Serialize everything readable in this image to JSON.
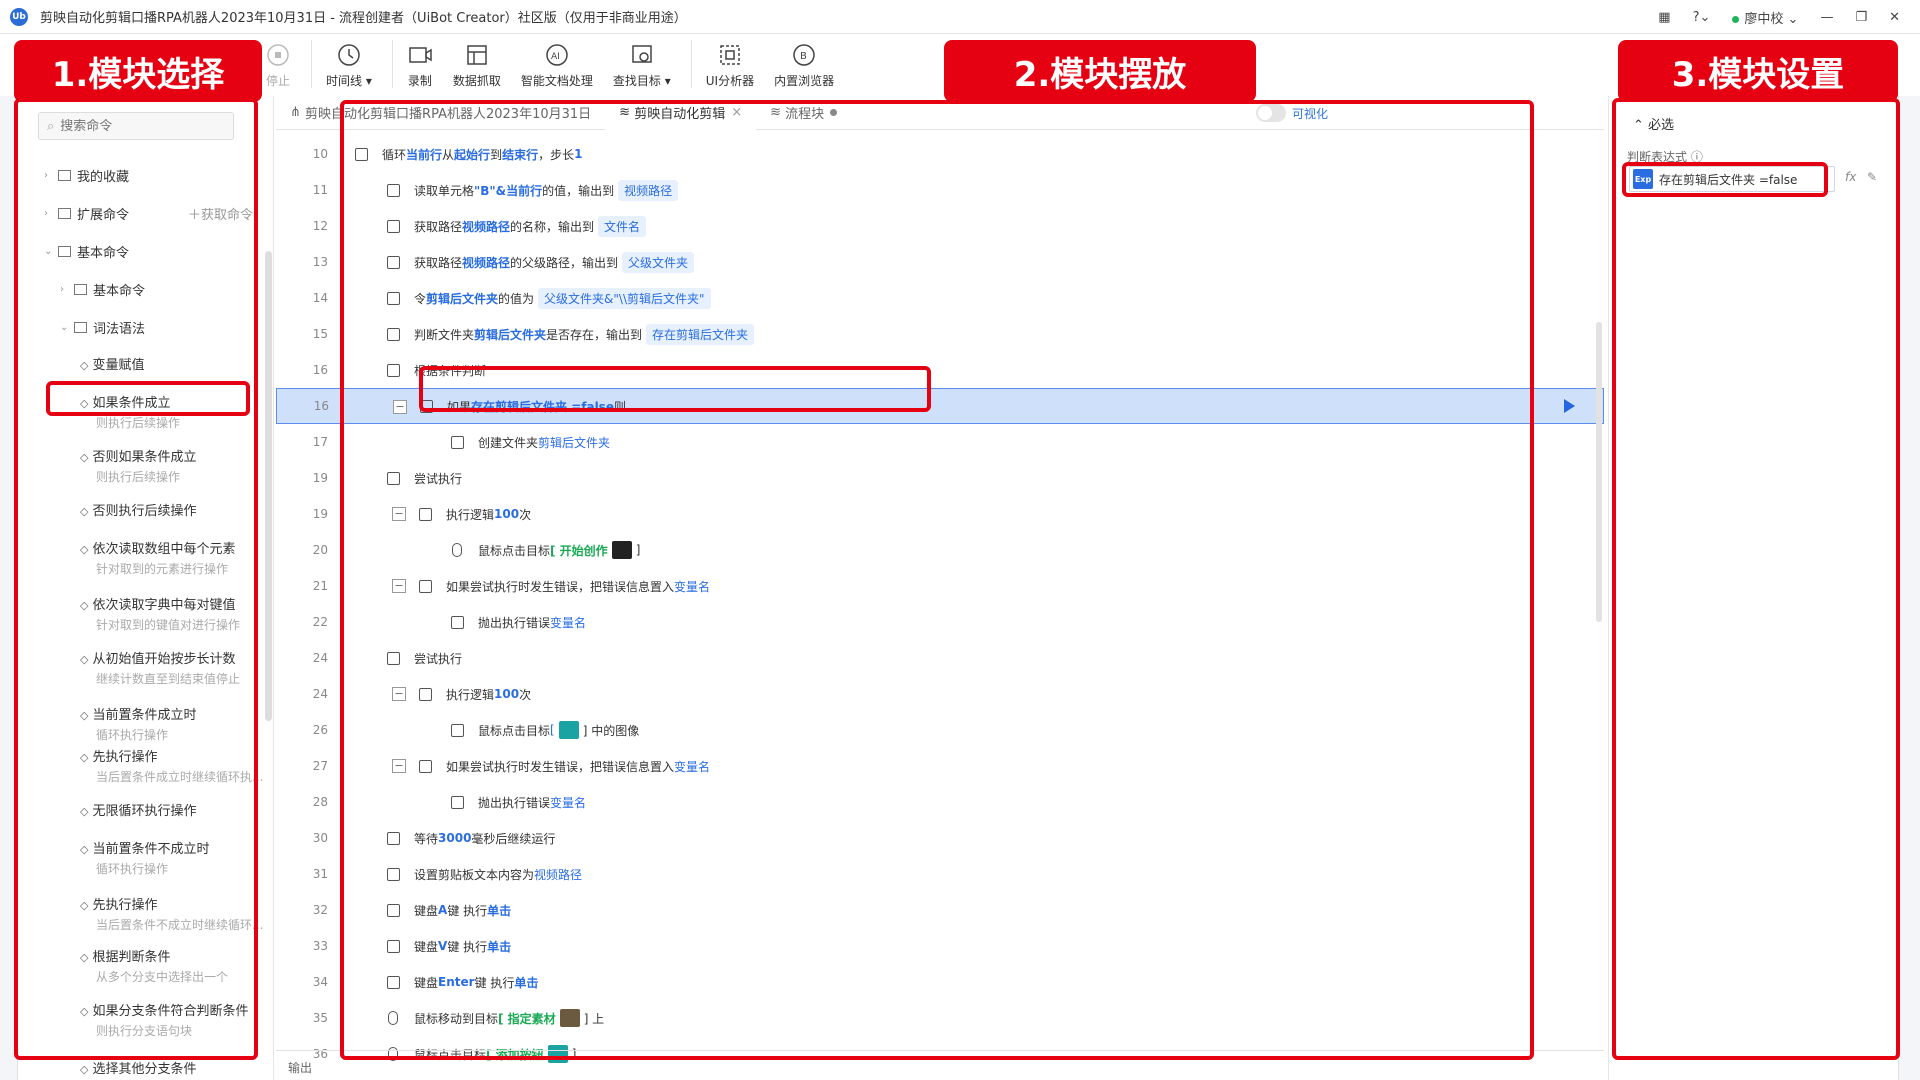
{
  "window": {
    "title": "剪映自动化剪辑口播RPA机器人2023年10月31日 - 流程创建者（UiBot Creator）社区版（仅用于非商业用途）",
    "logo": "Ub",
    "user": "廖中校"
  },
  "toolbar": {
    "stop": "停止",
    "timeline": "时间线",
    "record": "录制",
    "datagrab": "数据抓取",
    "smartdoc": "智能文档处理",
    "findtarget": "查找目标",
    "uianalyzer": "UI分析器",
    "browser": "内置浏览器"
  },
  "labels": {
    "l1": "1.模块选择",
    "l2": "2.模块摆放",
    "l3": "3.模块设置"
  },
  "left": {
    "search_placeholder": "搜索命令",
    "favorites": "我的收藏",
    "extension": "扩展命令",
    "get_cmd": "获取命令",
    "basic": "基本命令",
    "basic_sub": "基本命令",
    "syntax": "词法语法",
    "commands": [
      {
        "label": "变量赋值",
        "desc": ""
      },
      {
        "label": "如果条件成立",
        "desc": "则执行后续操作"
      },
      {
        "label": "否则如果条件成立",
        "desc": "则执行后续操作"
      },
      {
        "label": "否则执行后续操作",
        "desc": ""
      },
      {
        "label": "依次读取数组中每个元素",
        "desc": "针对取到的元素进行操作"
      },
      {
        "label": "依次读取字典中每对键值",
        "desc": "针对取到的键值对进行操作"
      },
      {
        "label": "从初始值开始按步长计数",
        "desc": "继续计数直至到结束值停止"
      },
      {
        "label": "当前置条件成立时",
        "desc": "循环执行操作"
      },
      {
        "label": "先执行操作",
        "desc": "当后置条件成立时继续循环执..."
      },
      {
        "label": "无限循环执行操作",
        "desc": ""
      },
      {
        "label": "当前置条件不成立时",
        "desc": "循环执行操作"
      },
      {
        "label": "先执行操作",
        "desc": "当后置条件不成立时继续循环..."
      },
      {
        "label": "根据判断条件",
        "desc": "从多个分支中选择出一个"
      },
      {
        "label": "如果分支条件符合判断条件",
        "desc": "则执行分支语句块"
      },
      {
        "label": "选择其他分支条件",
        "desc": ""
      }
    ]
  },
  "tabs": [
    {
      "label": "剪映自动化剪辑口播RPA机器人2023年10月31日"
    },
    {
      "label": "剪映自动化剪辑"
    },
    {
      "label": "流程块"
    }
  ],
  "visual_toggle": "可视化",
  "rows": [
    {
      "n": "10",
      "t": "循环 当前行 从 起始行 到 结束行 ，步长 1"
    },
    {
      "n": "11",
      "a": "读取单元格 ",
      "b": "\"B\"&当前行",
      "c": " 的值，输出到 ",
      "d": "视频路径"
    },
    {
      "n": "12",
      "a": "获取路径 ",
      "b": "视频路径",
      "c": " 的名称，输出到 ",
      "d": "文件名"
    },
    {
      "n": "13",
      "a": "获取路径 ",
      "b": "视频路径",
      "c": " 的父级路径，输出到 ",
      "d": "父级文件夹"
    },
    {
      "n": "14",
      "a": "令 ",
      "b": "剪辑后文件夹",
      "c": " 的值为 ",
      "d": "父级文件夹&\"\\\\剪辑后文件夹\""
    },
    {
      "n": "15",
      "a": "判断文件夹 ",
      "b": "剪辑后文件夹",
      "c": " 是否存在，输出到 ",
      "d": "存在剪辑后文件夹"
    },
    {
      "n": "16",
      "t": "根据条件判断"
    },
    {
      "n": "16",
      "a": "如果 ",
      "b": "存在剪辑后文件夹 =false",
      "c": " 则"
    },
    {
      "n": "17",
      "a": "创建文件夹 ",
      "b": "剪辑后文件夹"
    },
    {
      "n": "19",
      "t": "尝试执行"
    },
    {
      "n": "19",
      "a": "执行逻辑 ",
      "b": "100",
      "c": " 次"
    },
    {
      "n": "20",
      "a": "鼠标点击目标 ",
      "b": "[ 开始创作 ",
      "c": " ]"
    },
    {
      "n": "21",
      "a": "如果尝试执行时发生错误，把错误信息置入 ",
      "b": "变量名"
    },
    {
      "n": "22",
      "a": "抛出执行错误 ",
      "b": "变量名"
    },
    {
      "n": "24",
      "t": "尝试执行"
    },
    {
      "n": "24",
      "a": "执行逻辑 ",
      "b": "100",
      "c": " 次"
    },
    {
      "n": "26",
      "a": "鼠标点击目标 ",
      "b": "[ ",
      "c": " ] 中的图像"
    },
    {
      "n": "27",
      "a": "如果尝试执行时发生错误，把错误信息置入 ",
      "b": "变量名"
    },
    {
      "n": "28",
      "a": "抛出执行错误 ",
      "b": "变量名"
    },
    {
      "n": "30",
      "a": "等待 ",
      "b": "3000",
      "c": " 毫秒后继续运行"
    },
    {
      "n": "31",
      "a": "设置剪贴板文本内容为 ",
      "b": "视频路径"
    },
    {
      "n": "32",
      "a": "键盘 ",
      "b": "A",
      "c": " 键 执行 ",
      "d": "单击"
    },
    {
      "n": "33",
      "a": "键盘 ",
      "b": "V",
      "c": " 键 执行 ",
      "d": "单击"
    },
    {
      "n": "34",
      "a": "键盘 ",
      "b": "Enter",
      "c": " 键 执行 ",
      "d": "单击"
    },
    {
      "n": "35",
      "a": "鼠标移动到目标 ",
      "b": "[ 指定素材 ",
      "c": " ] 上"
    },
    {
      "n": "36",
      "a": "鼠标点击目标 ",
      "b": "[ 添加按钮 ",
      "c": " ]"
    }
  ],
  "loop_parts": {
    "a": "循环 ",
    "b": "当前行",
    "c": " 从 ",
    "d": "起始行",
    "e": " 到 ",
    "f": "结束行",
    "g": "，步长 ",
    "h": "1"
  },
  "output_label": "输出",
  "right": {
    "section": "必选",
    "field_label": "判断表达式",
    "exp_tag": "Exp",
    "exp_value": "存在剪辑后文件夹 =false",
    "fx": "fx"
  },
  "colors": {
    "accent": "#2a6de0",
    "highlight": "#e50012",
    "selected_row": "#cfe0fa"
  }
}
